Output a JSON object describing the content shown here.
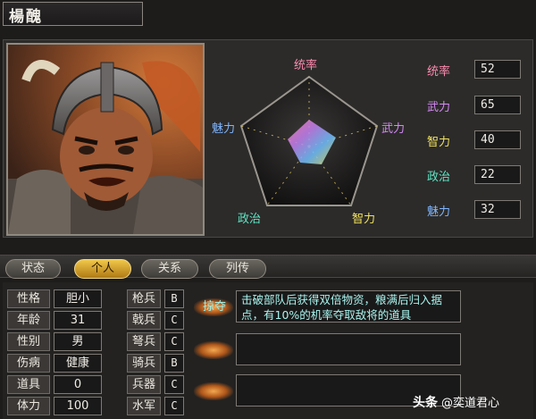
{
  "character": {
    "name": "楊醜"
  },
  "radar": {
    "labels": {
      "leadership": "统率",
      "war": "武力",
      "intelligence": "智力",
      "politics": "政治",
      "charm": "魅力"
    }
  },
  "stats": [
    {
      "label": "统率",
      "value": "52",
      "color": "#ff8ab0"
    },
    {
      "label": "武力",
      "value": "65",
      "color": "#d58af5"
    },
    {
      "label": "智力",
      "value": "40",
      "color": "#f2e25a"
    },
    {
      "label": "政治",
      "value": "22",
      "color": "#5fe6c4"
    },
    {
      "label": "魅力",
      "value": "32",
      "color": "#7fb6ff"
    }
  ],
  "tabs": [
    {
      "label": "状态",
      "active": false
    },
    {
      "label": "个人",
      "active": true
    },
    {
      "label": "关系",
      "active": false
    },
    {
      "label": "列传",
      "active": false
    }
  ],
  "attributes": [
    {
      "label": "性格",
      "value": "胆小"
    },
    {
      "label": "年龄",
      "value": "31"
    },
    {
      "label": "性别",
      "value": "男"
    },
    {
      "label": "伤病",
      "value": "健康"
    },
    {
      "label": "道具",
      "value": "0"
    },
    {
      "label": "体力",
      "value": "100"
    }
  ],
  "troops": [
    {
      "label": "枪兵",
      "grade": "B"
    },
    {
      "label": "戟兵",
      "grade": "C"
    },
    {
      "label": "弩兵",
      "grade": "C"
    },
    {
      "label": "骑兵",
      "grade": "B"
    },
    {
      "label": "兵器",
      "grade": "C"
    },
    {
      "label": "水军",
      "grade": "C"
    }
  ],
  "skills": [
    {
      "name": "掠夺",
      "description": "击破部队后获得双倍物资，粮满后归入据点，有10%的机率夺取敌将的道具"
    },
    {
      "name": "",
      "description": ""
    },
    {
      "name": "",
      "description": ""
    }
  ],
  "watermark": {
    "brand": "头条",
    "account": "@奕道君心"
  },
  "colors": {
    "active_tab": "#e8b630",
    "skill_text": "#a8f4ee"
  }
}
